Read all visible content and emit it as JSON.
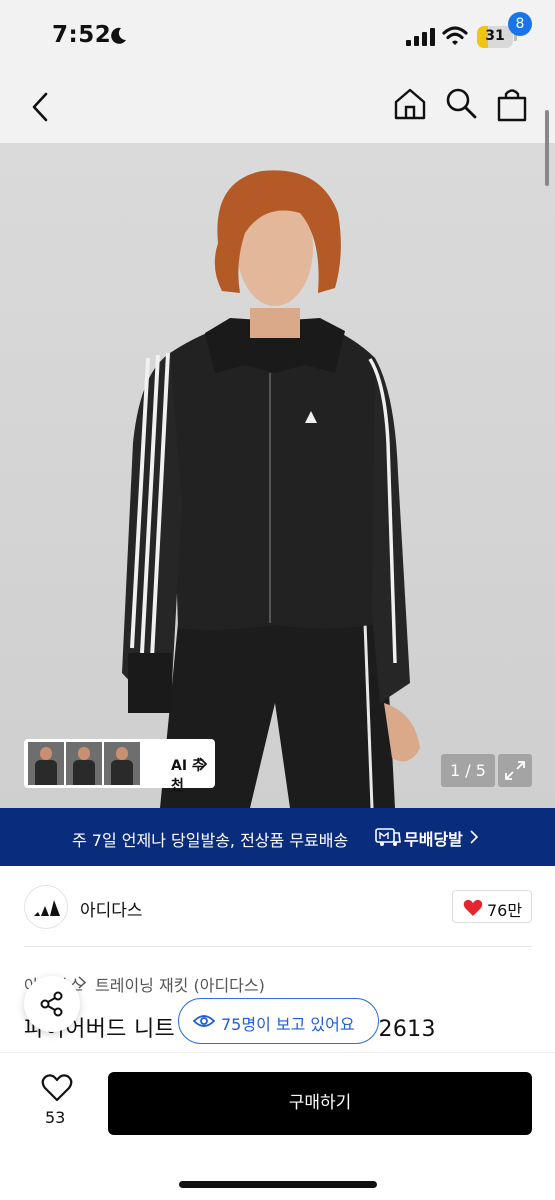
{
  "status_bar": {
    "time": "7:52",
    "battery": "31",
    "battery_level": 0.31,
    "icons": [
      "moon-icon",
      "signal-icon",
      "wifi-icon",
      "battery-icon"
    ]
  },
  "nav": {
    "cart_count": "8",
    "icons": [
      "back-icon",
      "home-icon",
      "search-icon",
      "cart-icon"
    ]
  },
  "gallery": {
    "ai_label": "AI 추천",
    "counter": "1 / 5",
    "current": 1,
    "total": 5
  },
  "banner": {
    "text": "주 7일 언제나 당일발송, 전상품 무료배송",
    "brand": "무배당발"
  },
  "brand": {
    "name": "아디다스",
    "likes": "76만"
  },
  "breadcrumb": {
    "first": "아디다스",
    "second": "트레이닝 재킷 (아디다스)"
  },
  "product": {
    "title": "파이어버드 니트 트랙 재킷 - 블랙 / JY2613"
  },
  "viewers": {
    "text": "75명이 보고 있어요"
  },
  "bottom_bar": {
    "wish_count": "53",
    "buy_label": "구매하기"
  },
  "colors": {
    "banner_bg": "#0a2c7d",
    "badge_blue": "#1a73e8",
    "viewer_blue": "#1f5ed8",
    "heart_red": "#e3262f"
  }
}
